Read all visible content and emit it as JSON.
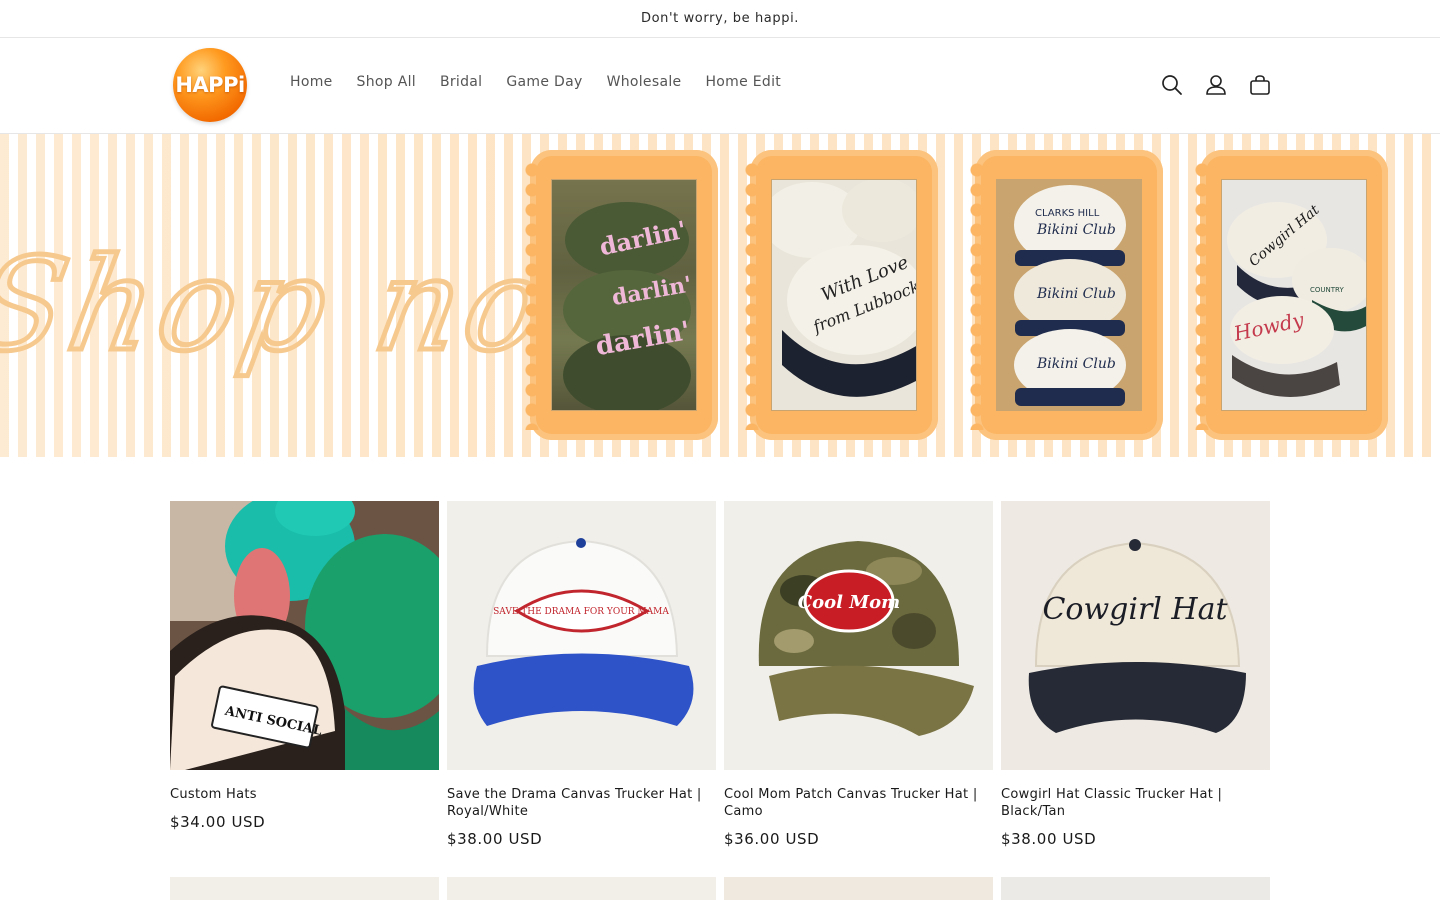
{
  "announcement": {
    "text": "Don't worry, be happi."
  },
  "header": {
    "logo_text": "HAPPi",
    "nav": [
      "Home",
      "Shop All",
      "Bridal",
      "Game Day",
      "Wholesale",
      "Home Edit"
    ],
    "icons": [
      "search-icon",
      "account-icon",
      "cart-icon"
    ]
  },
  "hero": {
    "headline": "Shop now",
    "photos": [
      {
        "name": "darlin-camo-hats",
        "lines": [
          "darlin'",
          "darlin'",
          "darlin'"
        ]
      },
      {
        "name": "with-love-lubbock-hats",
        "lines": [
          "With Love",
          "from Lubbock"
        ]
      },
      {
        "name": "clarks-hill-bikini-club-hats",
        "lines": [
          "CLARKS HILL",
          "Bikini Club"
        ]
      },
      {
        "name": "cowgirl-howdy-hats",
        "lines": [
          "Cowgirl Hat",
          "Howdy",
          "COUNTRY"
        ]
      }
    ]
  },
  "products": [
    {
      "title": "Custom Hats",
      "price": "$34.00 USD",
      "patch": "ANTI SOCIAL"
    },
    {
      "title": "Save the Drama Canvas Trucker Hat | Royal/White",
      "price": "$38.00 USD",
      "patch": "SAVE THE DRAMA FOR YOUR MAMA"
    },
    {
      "title": "Cool Mom Patch Canvas Trucker Hat | Camo",
      "price": "$36.00 USD",
      "patch": "Cool Mom"
    },
    {
      "title": "Cowgirl Hat Classic Trucker Hat | Black/Tan",
      "price": "$38.00 USD",
      "patch": "Cowgirl Hat"
    }
  ],
  "colors": {
    "stripe": "#fde4c4",
    "frame": "#fbb563",
    "script": "#f6c98f",
    "logo": "#f26a00"
  }
}
